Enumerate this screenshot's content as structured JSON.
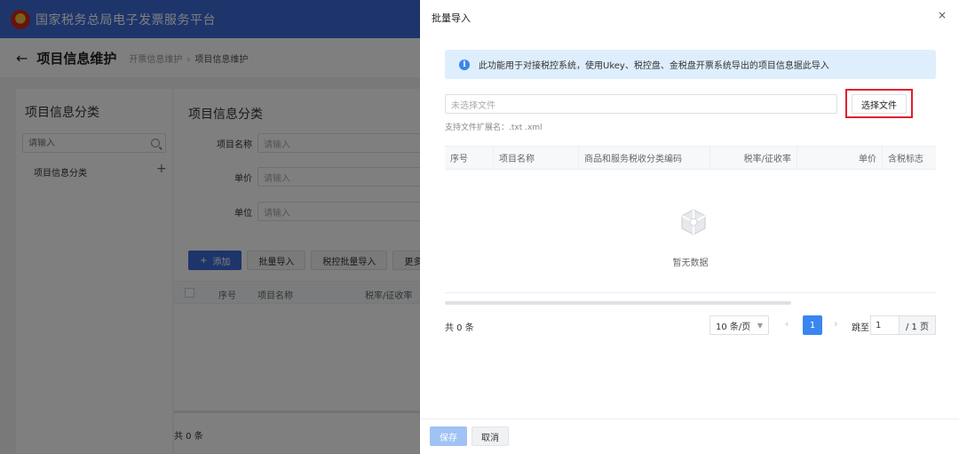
{
  "app": {
    "platform_title": "国家税务总局电子发票服务平台",
    "emblem_icon": "tax-emblem-icon",
    "brand_color": "#3c6bd6"
  },
  "page_header": {
    "back_icon": "back-arrow-icon",
    "back_glyph": "←",
    "title": "项目信息维护",
    "breadcrumb": [
      "开票信息维护",
      "项目信息维护"
    ],
    "breadcrumb_sep": "›"
  },
  "left_panel": {
    "title": "项目信息分类",
    "search_placeholder": "请输入",
    "tree_node": "项目信息分类",
    "add_glyph": "+"
  },
  "right_panel": {
    "title": "项目信息分类",
    "fields": [
      {
        "label": "项目名称",
        "placeholder": "请输入"
      },
      {
        "label": "单价",
        "placeholder": "请输入"
      },
      {
        "label": "单位",
        "placeholder": "请输入"
      }
    ],
    "select_chevron": "⌄",
    "buttons": {
      "add_icon": "+",
      "add": "添加",
      "batch_import": "批量导入",
      "tax_batch_import": "税控批量导入",
      "more": "更多操作"
    },
    "table_headers": [
      "序号",
      "项目名称",
      "税率/征收率"
    ],
    "total": "共 0 条"
  },
  "drawer": {
    "title": "批量导入",
    "close_glyph": "×",
    "info_icon_glyph": "i",
    "info_text": "此功能用于对接税控系统，使用Ukey、税控盘、金税盘开票系统导出的项目信息据此导入",
    "info_bg_color": "#dfeefd",
    "file_placeholder": "未选择文件",
    "choose_file": "选择文件",
    "highlight_color": "#e0202c",
    "ext_hint": "支持文件扩展名：.txt .xml",
    "table_headers": [
      "序号",
      "项目名称",
      "商品和服务税收分类编码",
      "税率/征收率",
      "单价",
      "含税标志"
    ],
    "empty_text": "暂无数据",
    "pagination": {
      "total": "共 0 条",
      "page_size": "10 条/页",
      "prev": "‹",
      "current": "1",
      "next": "›",
      "jump_label": "跳至",
      "jump_value": "1",
      "pages": "/ 1 页"
    },
    "save": "保存",
    "cancel": "取消"
  }
}
